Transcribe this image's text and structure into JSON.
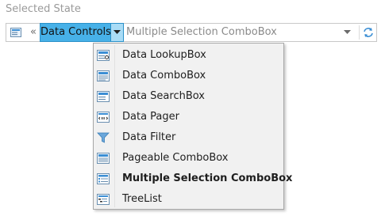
{
  "section_label": "Selected State",
  "breadcrumb": {
    "overflow_glyph": "«",
    "current_label": "Data Controls",
    "path_text": "Multiple Selection ComboBox"
  },
  "menu": {
    "items": [
      {
        "label": "Data LookupBox",
        "icon": "lookupbox-icon"
      },
      {
        "label": "Data ComboBox",
        "icon": "combobox-icon"
      },
      {
        "label": "Data SearchBox",
        "icon": "searchbox-icon"
      },
      {
        "label": "Data Pager",
        "icon": "pager-icon"
      },
      {
        "label": "Data Filter",
        "icon": "filter-icon"
      },
      {
        "label": "Pageable ComboBox",
        "icon": "pageable-combobox-icon"
      },
      {
        "label": "Multiple Selection ComboBox",
        "icon": "multiple-selection-combobox-icon",
        "selected": true
      },
      {
        "label": "TreeList",
        "icon": "treelist-icon"
      }
    ]
  },
  "colors": {
    "accent": "#47b1e8",
    "accent_border": "#2a90c8",
    "icon_blue": "#3b8ed4",
    "label_gray": "#9a9a9a"
  }
}
